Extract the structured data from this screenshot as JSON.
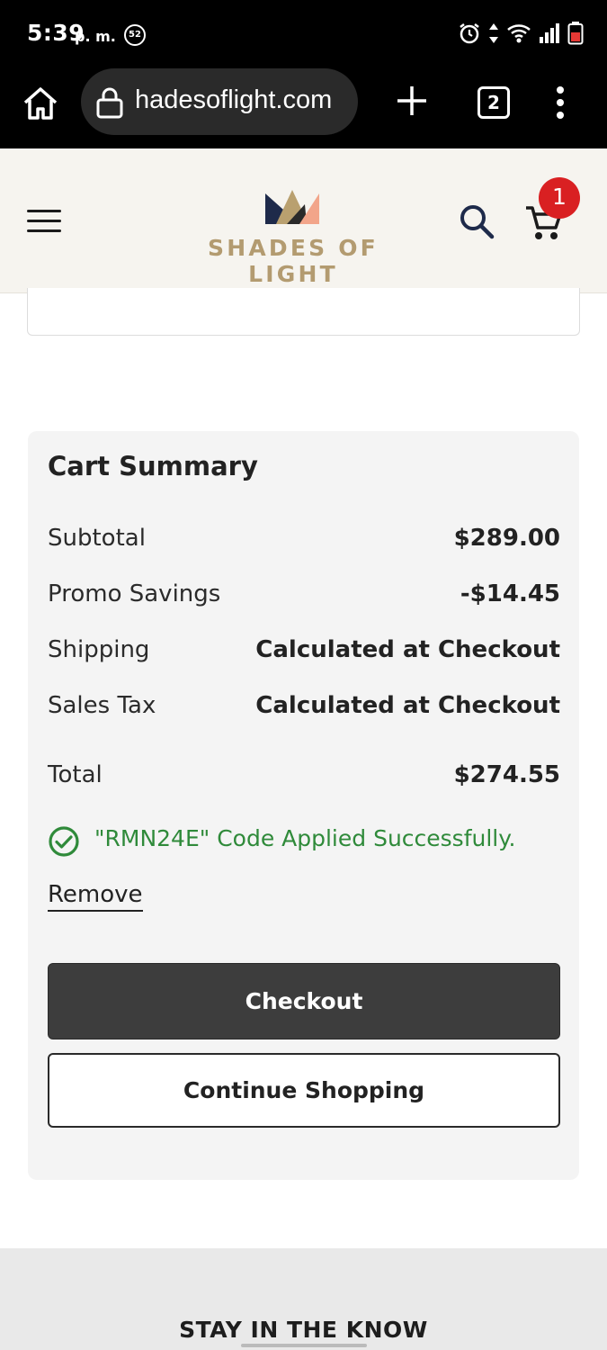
{
  "status_bar": {
    "time": "5:39",
    "ampm": "p. m.",
    "notification_badge": "52"
  },
  "browser": {
    "url": "hadesoflight.com",
    "tab_count": "2"
  },
  "header": {
    "logo_text": "SHADES OF LIGHT",
    "cart_count": "1",
    "colors": {
      "logo_gold": "#b39b70",
      "badge_red": "#d92022"
    }
  },
  "cart_summary": {
    "title": "Cart Summary",
    "rows": [
      {
        "label": "Subtotal",
        "value": "$289.00"
      },
      {
        "label": "Promo Savings",
        "value": "-$14.45"
      },
      {
        "label": "Shipping",
        "value": "Calculated at Checkout"
      },
      {
        "label": "Sales Tax",
        "value": "Calculated at Checkout"
      },
      {
        "label": "Total",
        "value": "$274.55"
      }
    ],
    "promo_message": "\"RMN24E\" Code Applied Successfully.",
    "promo_color": "#2f8a3a",
    "remove_label": "Remove",
    "checkout_label": "Checkout",
    "continue_label": "Continue Shopping"
  },
  "footer": {
    "heading": "STAY IN THE KNOW"
  }
}
